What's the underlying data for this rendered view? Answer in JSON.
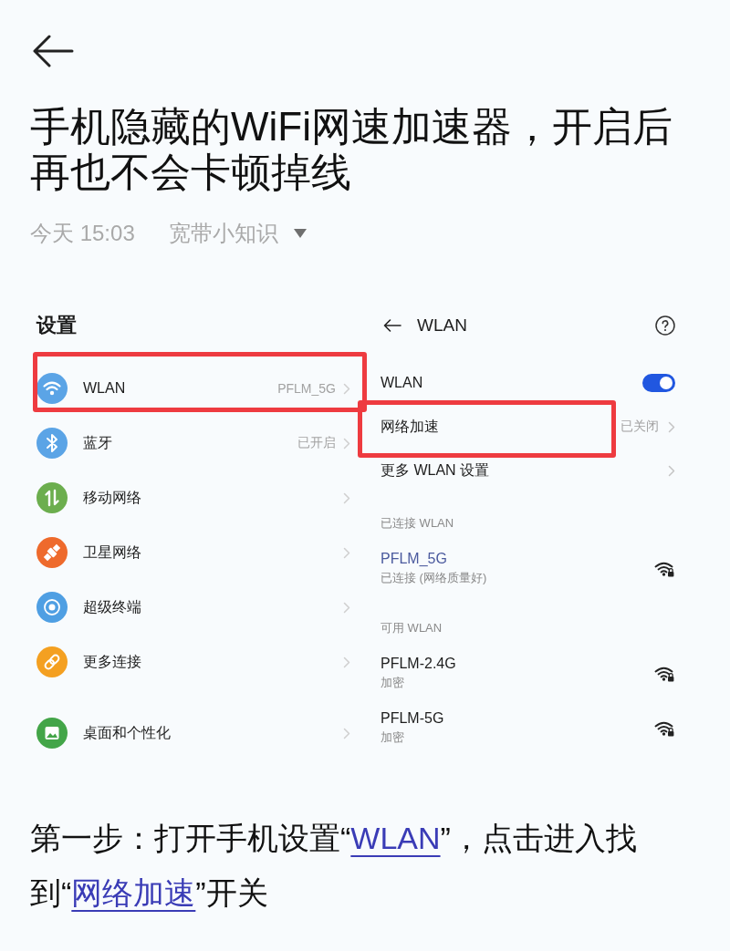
{
  "article": {
    "title": "手机隐藏的WiFi网速加速器，开启后再也不会卡顿掉线",
    "time": "今天 15:03",
    "author": "宽带小知识"
  },
  "screenshot": {
    "settings": {
      "title": "设置",
      "groups": [
        {
          "items": [
            {
              "kind": "wifi",
              "label": "WLAN",
              "value": "PFLM_5G",
              "color": "#5ba4e6",
              "highlighted": true
            },
            {
              "kind": "bluetooth",
              "label": "蓝牙",
              "value": "已开启",
              "color": "#5ba4e6",
              "highlighted": false
            },
            {
              "kind": "mobile",
              "label": "移动网络",
              "color": "#6cae4e",
              "highlighted": false
            },
            {
              "kind": "satellite",
              "label": "卫星网络",
              "color": "#ee6a2c",
              "highlighted": false
            },
            {
              "kind": "terminal",
              "label": "超级终端",
              "color": "#4f9fe3",
              "highlighted": false
            },
            {
              "kind": "link",
              "label": "更多连接",
              "color": "#f4a021",
              "highlighted": false
            }
          ]
        },
        {
          "items": [
            {
              "kind": "wallpaper",
              "label": "桌面和个性化",
              "color": "#43a548",
              "highlighted": false
            }
          ]
        }
      ]
    },
    "wlan": {
      "title": "WLAN",
      "rows": [
        {
          "kind": "toggle",
          "label": "WLAN",
          "on": true,
          "highlighted": false
        },
        {
          "kind": "link",
          "label": "网络加速",
          "value": "已关闭",
          "highlighted": true
        },
        {
          "kind": "link",
          "label": "更多 WLAN 设置",
          "highlighted": false
        }
      ],
      "sections": [
        {
          "title": "已连接 WLAN",
          "networks": [
            {
              "name": "PFLM_5G",
              "status": "已连接 (网络质量好)",
              "connected": true
            }
          ]
        },
        {
          "title": "可用 WLAN",
          "networks": [
            {
              "name": "PFLM-2.4G",
              "status": "加密",
              "connected": false
            },
            {
              "name": "PFLM-5G",
              "status": "加密",
              "connected": false
            }
          ]
        }
      ]
    }
  },
  "body": {
    "segments": [
      {
        "kind": "text",
        "text": "第一步：打开手机设置“"
      },
      {
        "kind": "link",
        "text": "WLAN"
      },
      {
        "kind": "text",
        "text": "”，点击进入找到“"
      },
      {
        "kind": "link",
        "text": "网络加速"
      },
      {
        "kind": "text",
        "text": "”开关"
      }
    ]
  }
}
